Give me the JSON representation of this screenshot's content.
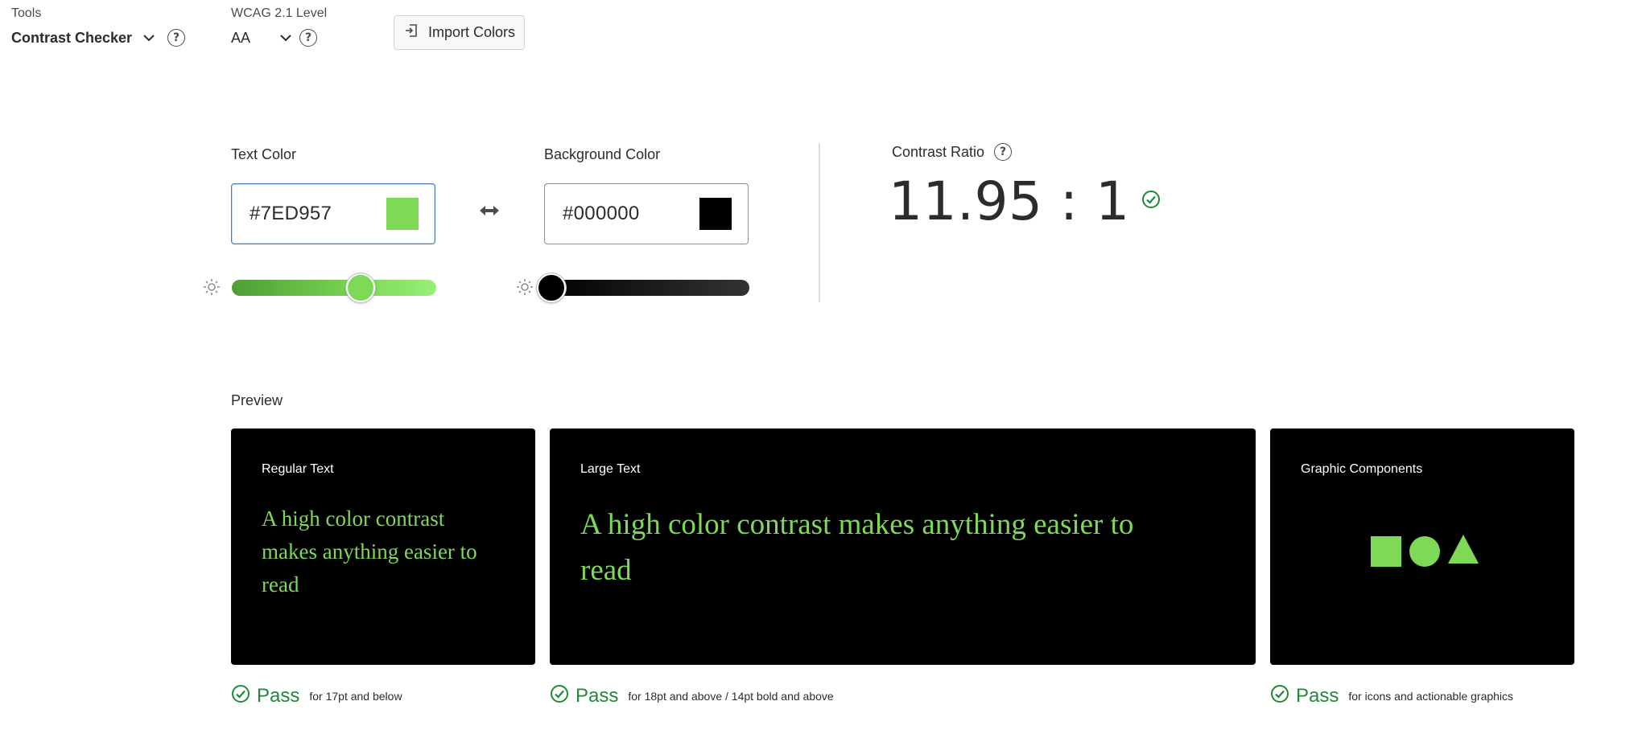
{
  "toolbar": {
    "tools_label": "Tools",
    "tools_value": "Contrast Checker",
    "wcag_label": "WCAG 2.1 Level",
    "wcag_value": "AA",
    "import_label": "Import Colors"
  },
  "text_color": {
    "label": "Text Color",
    "hex": "#7ED957",
    "color": "#7ED957",
    "brightness": 0.65
  },
  "background_color": {
    "label": "Background Color",
    "hex": "#000000",
    "color": "#000000",
    "brightness": 0.0
  },
  "contrast": {
    "label": "Contrast Ratio",
    "value": "11.95 : 1"
  },
  "preview": {
    "label": "Preview",
    "cards": {
      "regular": {
        "title": "Regular Text",
        "sample": "A high color contrast makes anything easier to read",
        "result": "Pass",
        "note": "for 17pt and below"
      },
      "large": {
        "title": "Large Text",
        "sample": "A high color contrast makes anything easier to read",
        "result": "Pass",
        "note": "for 18pt and above / 14pt bold and above"
      },
      "graphic": {
        "title": "Graphic Components",
        "result": "Pass",
        "note": "for icons and actionable graphics"
      }
    }
  },
  "colors": {
    "pass_green": "#1F8A3C",
    "sample_green": "#7ED957",
    "card_bg": "#000000"
  }
}
